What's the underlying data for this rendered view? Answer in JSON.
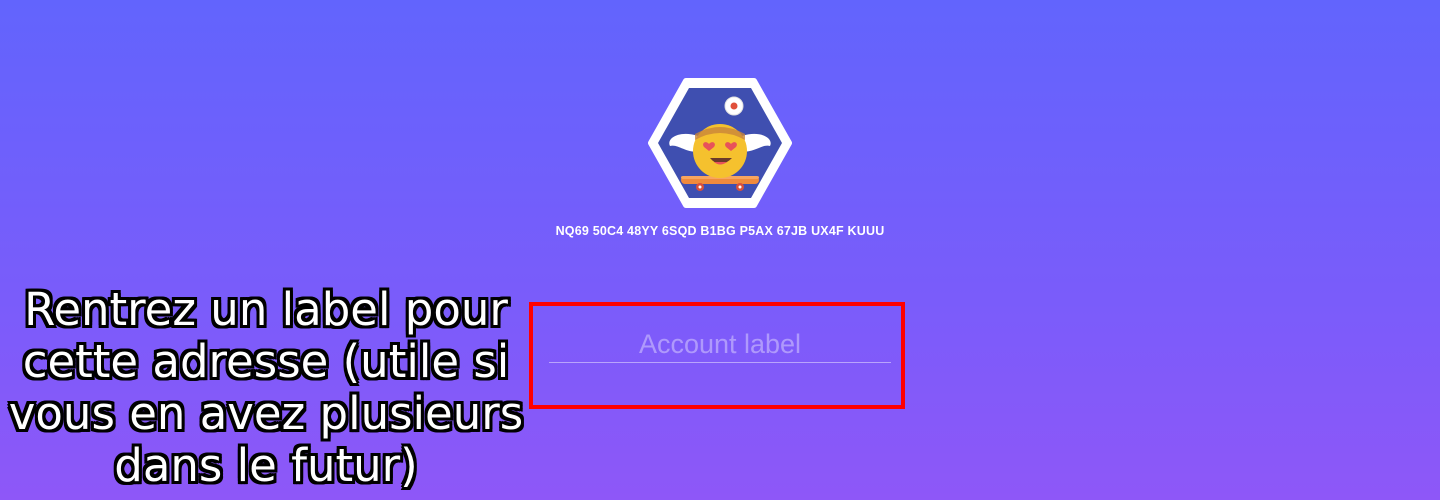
{
  "account": {
    "address": "NQ69 50C4 48YY 6SQD B1BG P5AX 67JB UX4F KUUU",
    "avatar_icon": "identicon-avatar-icon"
  },
  "label_field": {
    "placeholder": "Account label",
    "value": ""
  },
  "annotation": {
    "text": "Rentrez un label pour cette adresse (utile si vous en avez plusieurs dans le futur)",
    "highlight_color": "#ff0000"
  },
  "colors": {
    "background_top": "#6264fd",
    "background_bottom": "#8e57f8",
    "avatar_bg": "#3f4fb0",
    "avatar_face": "#f5c12e"
  }
}
